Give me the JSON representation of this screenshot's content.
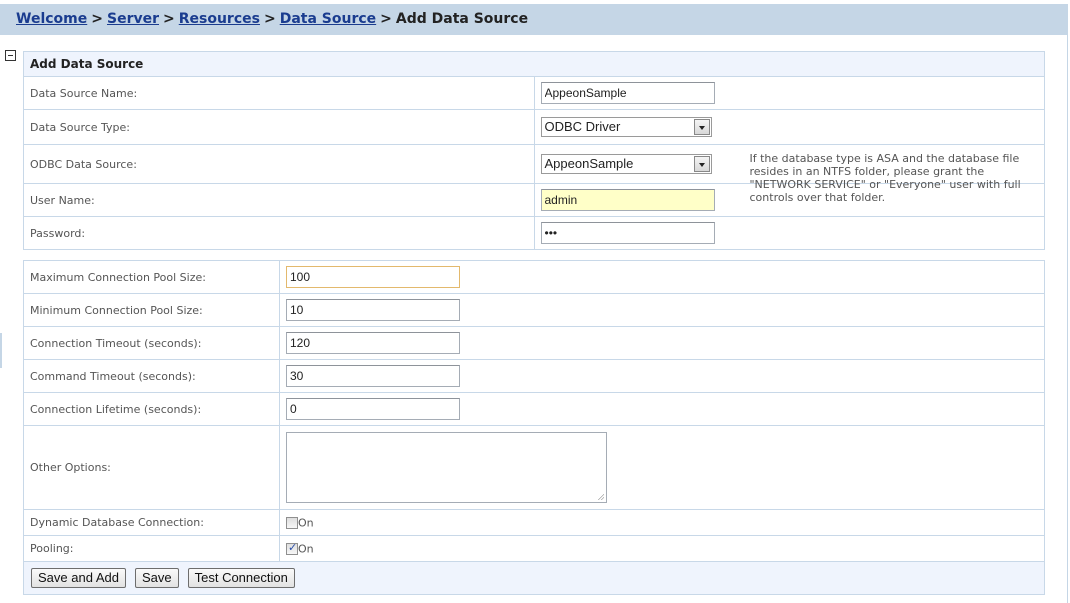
{
  "breadcrumb": {
    "links": [
      "Welcome",
      "Server",
      "Resources",
      "Data Source"
    ],
    "current": "Add Data Source",
    "separator": ">"
  },
  "section": {
    "title": "Add Data Source",
    "collapse_icon": "collapse-minus-icon"
  },
  "fields": {
    "data_source_name": {
      "label": "Data Source Name:",
      "value": "AppeonSample"
    },
    "data_source_type": {
      "label": "Data Source Type:",
      "value": "ODBC Driver"
    },
    "odbc_data_source": {
      "label": "ODBC Data Source:",
      "value": "AppeonSample",
      "hint_line1": "If the database type is ASA and the database file resides in an NTFS folder, please grant the",
      "hint_line2": "\"NETWORK SERVICE\" or \"Everyone\" user with full controls over that folder."
    },
    "user_name": {
      "label": "User Name:",
      "value": "admin"
    },
    "password": {
      "label": "Password:",
      "value": "•••"
    },
    "max_pool_size": {
      "label": "Maximum Connection Pool Size:",
      "value": "100"
    },
    "min_pool_size": {
      "label": "Minimum Connection Pool Size:",
      "value": "10"
    },
    "connection_timeout": {
      "label": "Connection Timeout (seconds):",
      "value": "120"
    },
    "command_timeout": {
      "label": "Command Timeout (seconds):",
      "value": "30"
    },
    "connection_lifetime": {
      "label": "Connection Lifetime (seconds):",
      "value": "0"
    },
    "other_options": {
      "label": "Other Options:",
      "value": ""
    },
    "dynamic_db_connection": {
      "label": "Dynamic Database Connection:",
      "checked": false,
      "option_label": "On"
    },
    "pooling": {
      "label": "Pooling:",
      "checked": true,
      "option_label": "On"
    }
  },
  "buttons": {
    "save_and_add": "Save and Add",
    "save": "Save",
    "test_connection": "Test Connection"
  }
}
